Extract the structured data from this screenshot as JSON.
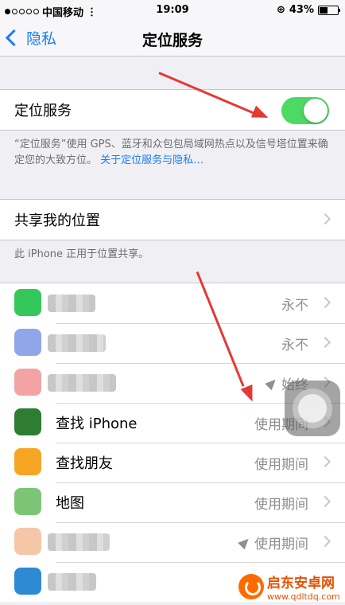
{
  "status": {
    "carrier": "中国移动",
    "time": "19:09",
    "battery": "43%",
    "battery_level": 0.43
  },
  "nav": {
    "back_label": "隐私",
    "title": "定位服务"
  },
  "location": {
    "label": "定位服务",
    "enabled": true,
    "note": "“定位服务”使用 GPS、蓝牙和众包包局域网热点以及信号塔位置来确定您的大致方位。",
    "note_link": "关于定位服务与隐私…"
  },
  "share": {
    "label": "共享我的位置",
    "note": "此 iPhone 正用于位置共享。"
  },
  "apps": [
    {
      "label": "",
      "value": "永不",
      "icon": "messages-green-icon",
      "color": "#34c759",
      "blurred": true,
      "arrow": false
    },
    {
      "label": "",
      "value": "永不",
      "icon": "app-blue-icon",
      "color": "#8fa6e8",
      "blurred": true,
      "arrow": false
    },
    {
      "label": "",
      "value": "始终",
      "icon": "app-pink-icon",
      "color": "#f3a3a3",
      "blurred": true,
      "arrow": true
    },
    {
      "label": "查找 iPhone",
      "value": "使用期间",
      "icon": "find-iphone-icon",
      "color": "#2e7d32",
      "blurred": false,
      "arrow": false
    },
    {
      "label": "查找朋友",
      "value": "使用期间",
      "icon": "find-friends-icon",
      "color": "#f6a623",
      "blurred": false,
      "arrow": false
    },
    {
      "label": "地图",
      "value": "使用期间",
      "icon": "maps-icon",
      "color": "#7cc576",
      "blurred": false,
      "arrow": false
    },
    {
      "label": "",
      "value": "使用期间",
      "icon": "app-peach-icon",
      "color": "#f5c6a8",
      "blurred": true,
      "arrow": true
    },
    {
      "label": "",
      "value": "",
      "icon": "app-blue2-icon",
      "color": "#2f8ad4",
      "blurred": true,
      "arrow": false
    }
  ],
  "watermark": {
    "title": "启东安卓网",
    "url": "www.qdltdq.com"
  }
}
